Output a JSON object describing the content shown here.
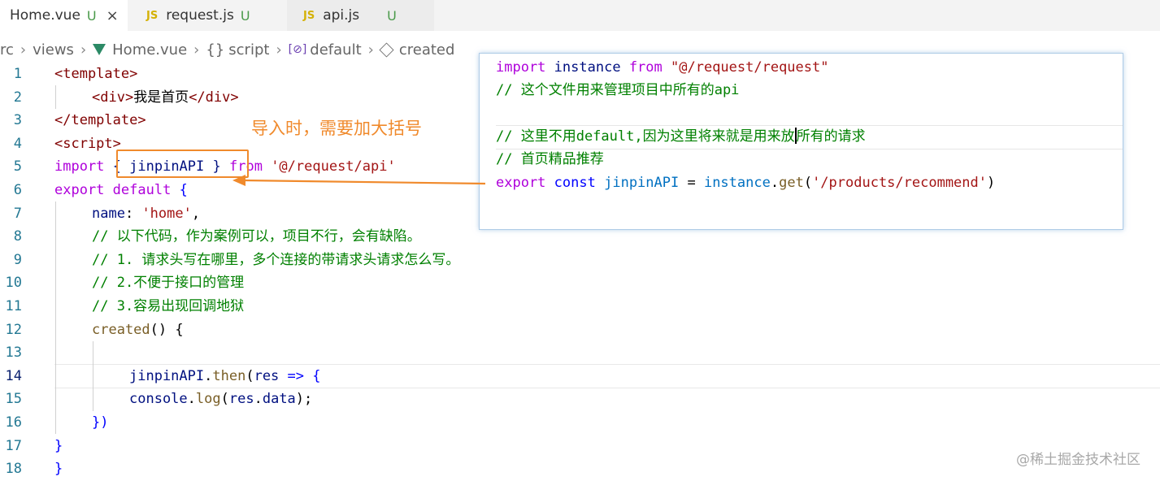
{
  "tabs": [
    {
      "label": "Home.vue",
      "status": "U",
      "close": "×"
    },
    {
      "label": "request.js",
      "status": "U",
      "type": "JS"
    },
    {
      "label": "api.js",
      "status": "U",
      "type": "JS"
    }
  ],
  "breadcrumb": {
    "src": "rc",
    "views": "views",
    "file": "Home.vue",
    "script_icon": "{}",
    "script": "script",
    "default_icon": "[⊘]",
    "default": "default",
    "created": "created"
  },
  "code": {
    "line_numbers": [
      "1",
      "2",
      "3",
      "4",
      "5",
      "6",
      "7",
      "8",
      "9",
      "10",
      "11",
      "12",
      "13",
      "14",
      "15",
      "16",
      "17",
      "18"
    ],
    "l1": "<template>",
    "l2a": "<div>",
    "l2b": "我是首页",
    "l2c": "</div>",
    "l3": "</template>",
    "l4": "<script>",
    "l5a": "import",
    "l5b": "{ jinpinAPI }",
    "l5c": "from",
    "l5d": "'@/request/api'",
    "l6a": "export",
    "l6b": "default",
    "l6c": "{",
    "l7a": "name",
    "l7b": ": ",
    "l7c": "'home'",
    "l7d": ",",
    "l8": "// 以下代码，作为案例可以，项目不行，会有缺陷。",
    "l9": "// 1. 请求头写在哪里，多个连接的带请求头请求怎么写。",
    "l10": "// 2.不便于接口的管理",
    "l11": "// 3.容易出现回调地狱",
    "l12a": "created",
    "l12b": "() {",
    "l14a": "jinpinAPI",
    "l14b": ".",
    "l14c": "then",
    "l14d": "(",
    "l14e": "res",
    "l14f": " => {",
    "l15a": "console",
    "l15b": ".",
    "l15c": "log",
    "l15d": "(",
    "l15e": "res",
    "l15f": ".",
    "l15g": "data",
    "l15h": ");",
    "l16": "})",
    "l17": "}",
    "l18": "}"
  },
  "popup": {
    "p1a": "import",
    "p1b": "instance",
    "p1c": "from",
    "p1d": "\"@/request/request\"",
    "p2": "// 这个文件用来管理项目中所有的api",
    "p4a": "// 这里不用default,因为这里将来就是用来放",
    "p4b": "所有的请求",
    "p5": "// 首页精品推荐",
    "p6a": "export",
    "p6b": "const",
    "p6c": "jinpinAPI",
    "p6d": " = ",
    "p6e": "instance",
    "p6f": ".",
    "p6g": "get",
    "p6h": "(",
    "p6i": "'/products/recommend'",
    "p6j": ")"
  },
  "annotation": "导入时，需要加大括号",
  "watermark": "@稀土掘金技术社区",
  "colors": {
    "annotation": "#f08a2c",
    "keyword": "#0000ff",
    "string": "#a31515",
    "comment": "#008000"
  }
}
